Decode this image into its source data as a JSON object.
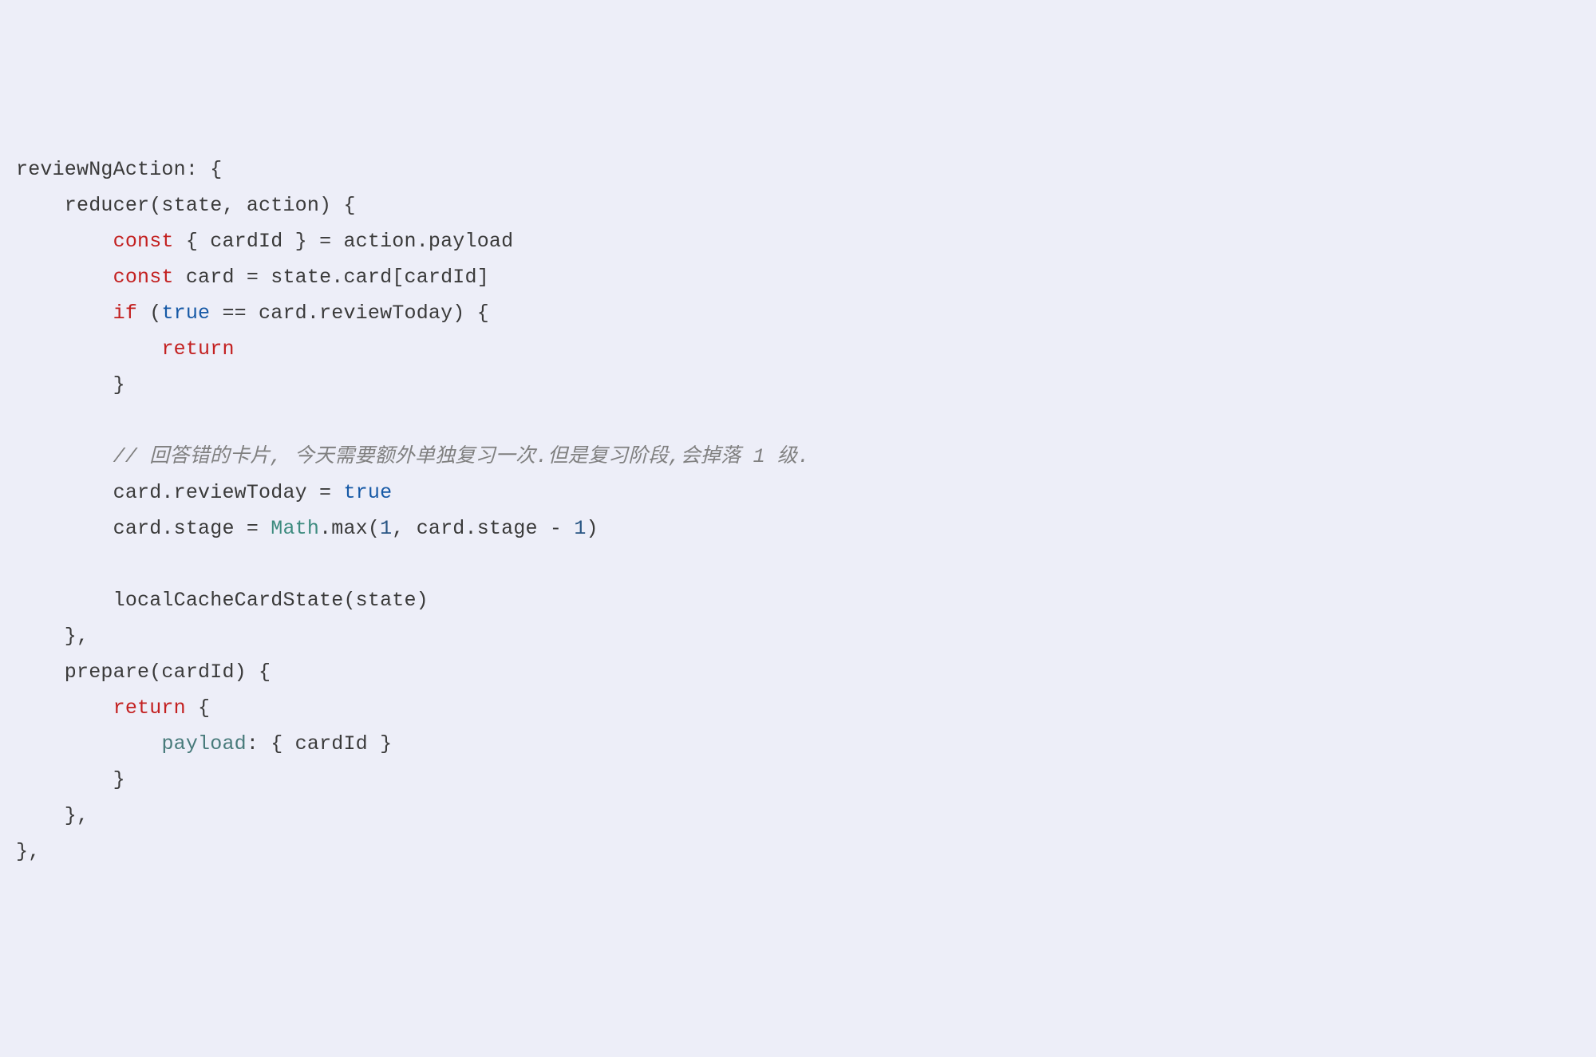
{
  "code": {
    "line1": {
      "a": "reviewNgAction: {"
    },
    "line2": {
      "a": "    reducer(state, action) {"
    },
    "line3": {
      "a": "        ",
      "kw": "const",
      "b": " { cardId } = action.payload"
    },
    "line4": {
      "a": "        ",
      "kw": "const",
      "b": " card = state.card[cardId]"
    },
    "line5": {
      "a": "        ",
      "kw": "if",
      "b": " (",
      "bool": "true",
      "c": " == card.reviewToday) {"
    },
    "line6": {
      "a": "            ",
      "kw": "return"
    },
    "line7": {
      "a": "        }"
    },
    "line8": {
      "a": " "
    },
    "line9": {
      "a": "        ",
      "comment": "// 回答错的卡片, 今天需要额外单独复习一次.但是复习阶段,会掉落 1 级."
    },
    "line10": {
      "a": "        card.reviewToday = ",
      "bool": "true"
    },
    "line11": {
      "a": "        card.stage = ",
      "class": "Math",
      "b": ".max(",
      "num1": "1",
      "c": ", card.stage - ",
      "num2": "1",
      "d": ")"
    },
    "line12": {
      "a": " "
    },
    "line13": {
      "a": "        localCacheCardState(state)"
    },
    "line14": {
      "a": "    },"
    },
    "line15": {
      "a": "    prepare(cardId) {"
    },
    "line16": {
      "a": "        ",
      "kw": "return",
      "b": " {"
    },
    "line17": {
      "a": "            ",
      "prop": "payload",
      "b": ": { cardId }"
    },
    "line18": {
      "a": "        }"
    },
    "line19": {
      "a": "    },"
    },
    "line20": {
      "a": "},"
    }
  }
}
